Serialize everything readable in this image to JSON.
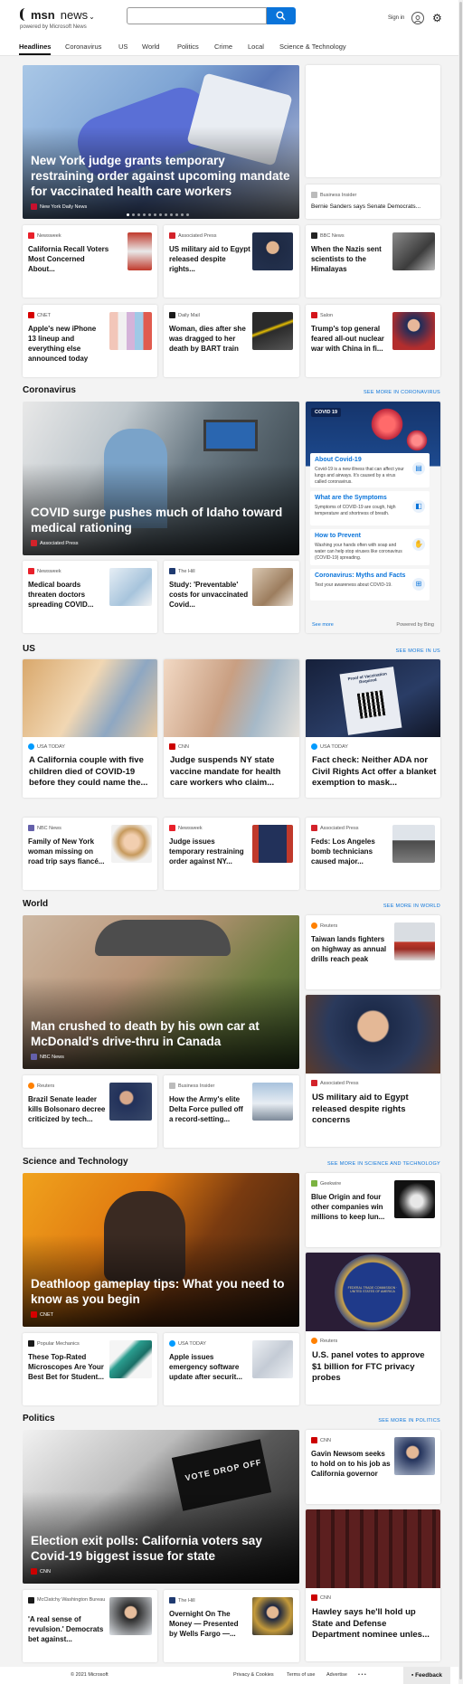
{
  "header": {
    "brand": "msn",
    "section": "news",
    "chevron": "⌄",
    "powered_by": "powered by Microsoft News",
    "search_value": "",
    "signin": "Sign in"
  },
  "nav": {
    "tabs": [
      {
        "label": "Headlines"
      },
      {
        "label": "Coronavirus"
      },
      {
        "label": "US"
      },
      {
        "label": "World"
      },
      {
        "label": "Politics"
      },
      {
        "label": "Crime"
      },
      {
        "label": "Local"
      },
      {
        "label": "Science & Technology"
      }
    ]
  },
  "top": {
    "hero": {
      "title": "New York judge grants temporary restraining order against upcoming mandate for vaccinated health care workers",
      "source": "New York Daily News",
      "logo_color": "#c8102e"
    },
    "side": {
      "source": "Business Insider",
      "title": "Bernie Sanders says Senate Democrats...",
      "logo_color": "#bbbbbb"
    },
    "cards": [
      {
        "source": "Newsweek",
        "title": "California Recall Voters Most Concerned About...",
        "logo_color": "#e8202a"
      },
      {
        "source": "Associated Press",
        "title": "US military aid to Egypt released despite rights...",
        "logo_color": "#d3222a"
      },
      {
        "source": "BBC News",
        "title": "When the Nazis sent scientists to the Himalayas",
        "logo_color": "#222222"
      },
      {
        "source": "CNET",
        "title": "Apple's new iPhone 13 lineup and everything else announced today",
        "logo_color": "#d60000"
      },
      {
        "source": "Daily Mail",
        "title": "Woman, dies after she was dragged to her death by BART train",
        "logo_color": "#1a1a1a"
      },
      {
        "source": "Salon",
        "title": "Trump's top general feared all-out nuclear war with China in fi...",
        "logo_color": "#d4151b"
      }
    ]
  },
  "coronavirus": {
    "heading": "Coronavirus",
    "see_more": "SEE MORE IN CORONAVIRUS",
    "hero": {
      "title": "COVID surge pushes much of Idaho toward medical rationing",
      "source": "Associated Press",
      "logo_color": "#d3222a"
    },
    "cards": [
      {
        "source": "Newsweek",
        "title": "Medical boards threaten doctors spreading COVID...",
        "logo_color": "#e8202a"
      },
      {
        "source": "The Hill",
        "title": "Study: 'Preventable' costs for unvaccinated Covid...",
        "logo_color": "#1f3a70"
      }
    ],
    "panel": {
      "tag": "COVID 19",
      "items": [
        {
          "title": "About Covid-19",
          "desc": "Covid-19 is a new illness that can affect your lungs and airways. It's caused by a virus called coronavirus.",
          "icon": "▤"
        },
        {
          "title": "What are the Symptoms",
          "desc": "Symptoms of COVID-19 are cough, high temperature and shortness of breath.",
          "icon": "◧"
        },
        {
          "title": "How to Prevent",
          "desc": "Washing your hands often with soap and water can help stop viruses like coronavirus (COVID-19) spreading.",
          "icon": "✋"
        },
        {
          "title": "Coronavirus: Myths and Facts",
          "desc": "Test your awareness about COVID-19.",
          "icon": "⊞"
        }
      ],
      "see_more": "See more",
      "powered": "Powered by Bing"
    }
  },
  "us": {
    "heading": "US",
    "see_more": "SEE MORE IN US",
    "big": [
      {
        "source": "USA TODAY",
        "title": "A California couple with five children died of COVID-19 before they could name the...",
        "logo_color": "#009bff"
      },
      {
        "source": "CNN",
        "title": "Judge suspends NY state vaccine mandate for health care workers who claim...",
        "logo_color": "#cc0000"
      },
      {
        "source": "USA TODAY",
        "title": "Fact check: Neither ADA nor Civil Rights Act offer a blanket exemption to mask...",
        "logo_color": "#009bff"
      }
    ],
    "image_text": "Proof of Vaccination Required",
    "cards": [
      {
        "source": "NBC News",
        "title": "Family of New York woman missing on road trip says fiancé...",
        "logo_color": "#6460aa"
      },
      {
        "source": "Newsweek",
        "title": "Judge issues temporary restraining order against NY...",
        "logo_color": "#e8202a"
      },
      {
        "source": "Associated Press",
        "title": "Feds: Los Angeles bomb technicians caused major...",
        "logo_color": "#d3222a"
      }
    ]
  },
  "world": {
    "heading": "World",
    "see_more": "SEE MORE IN WORLD",
    "hero": {
      "title": "Man crushed to death by his own car at McDonald's drive-thru in Canada",
      "source": "NBC News",
      "logo_color": "#6460aa"
    },
    "side": {
      "source": "Reuters",
      "title": "Taiwan lands fighters on highway as annual drills reach peak",
      "logo_color": "#ff8000"
    },
    "feature": {
      "source": "Associated Press",
      "title": "US military aid to Egypt released despite rights concerns",
      "logo_color": "#d3222a"
    },
    "cards": [
      {
        "source": "Reuters",
        "title": "Brazil Senate leader kills Bolsonaro decree criticized by tech...",
        "logo_color": "#ff8000"
      },
      {
        "source": "Business Insider",
        "title": "How the Army's elite Delta Force pulled off a record-setting...",
        "logo_color": "#bbbbbb"
      }
    ]
  },
  "science": {
    "heading": "Science and Technology",
    "see_more": "SEE MORE IN SCIENCE AND TECHNOLOGY",
    "hero": {
      "title": "Deathloop gameplay tips: What you need to know as you begin",
      "source": "CNET",
      "logo_color": "#d60000"
    },
    "side": {
      "source": "Geekwire",
      "title": "Blue Origin and four other companies win millions to keep lun...",
      "logo_color": "#7cb342"
    },
    "feature": {
      "source": "Reuters",
      "title": "U.S. panel votes to approve $1 billion for FTC privacy probes",
      "logo_color": "#ff8000"
    },
    "seal_text": "FEDERAL TRADE COMMISSION · UNITED STATES OF AMERICA",
    "cards": [
      {
        "source": "Popular Mechanics",
        "title": "These Top-Rated Microscopes Are Your Best Bet for Student...",
        "logo_color": "#1a1a1a"
      },
      {
        "source": "USA TODAY",
        "title": "Apple issues emergency software update after securit...",
        "logo_color": "#009bff"
      }
    ]
  },
  "politics": {
    "heading": "Politics",
    "see_more": "SEE MORE IN POLITICS",
    "hero": {
      "title": "Election exit polls: California voters say Covid-19 biggest issue for state",
      "source": "CNN",
      "logo_color": "#cc0000"
    },
    "image_text": "VOTE DROP OFF",
    "side": {
      "source": "CNN",
      "title": "Gavin Newsom seeks to hold on to his job as California governor",
      "logo_color": "#cc0000"
    },
    "feature": {
      "source": "CNN",
      "title": "Hawley says he'll hold up State and Defense Department nominee unles...",
      "logo_color": "#cc0000"
    },
    "cards": [
      {
        "source": "McClatchy Washington Bureau",
        "title": "'A real sense of revulsion.' Democrats bet against...",
        "logo_color": "#1a1a1a"
      },
      {
        "source": "The Hill",
        "title": "Overnight On The Money — Presented by Wells Fargo —...",
        "logo_color": "#1f3a70"
      }
    ]
  },
  "footer": {
    "copyright": "© 2021 Microsoft",
    "links": [
      "Privacy & Cookies",
      "Terms of use",
      "Advertise"
    ],
    "more": "• • •",
    "feedback": "Feedback"
  }
}
